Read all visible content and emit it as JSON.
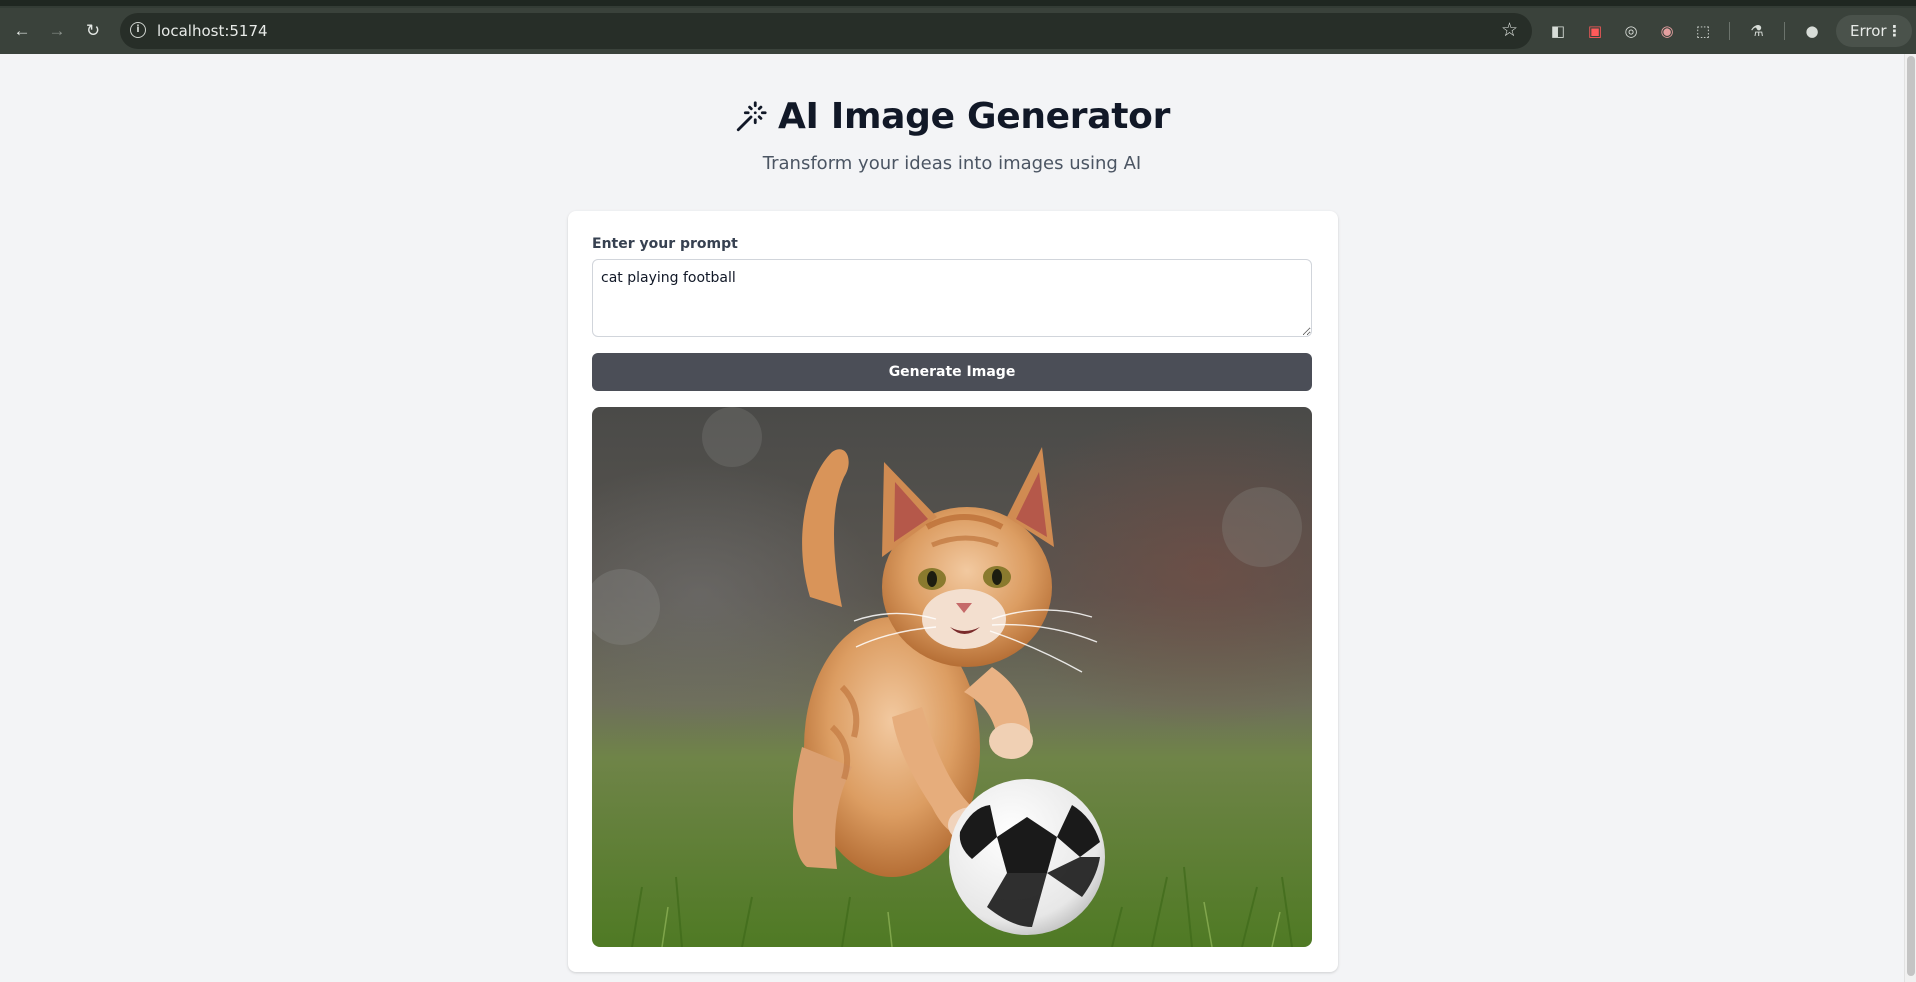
{
  "browser": {
    "url": "localhost:5174",
    "status_label": "Error",
    "icons": [
      "back-icon",
      "forward-icon",
      "reload-icon",
      "site-info-icon",
      "star-icon",
      "extensions-icon",
      "labs-icon",
      "profile-icon",
      "menu-icon"
    ]
  },
  "page": {
    "title": "AI Image Generator",
    "subtitle": "Transform your ideas into images using AI"
  },
  "form": {
    "prompt_label": "Enter your prompt",
    "prompt_value": "cat playing football",
    "generate_label": "Generate Image"
  },
  "result": {
    "image_description_icon": "generated-image"
  },
  "colors": {
    "page_bg": "#f3f4f6",
    "button_bg": "#4b4e57",
    "title_text": "#111827",
    "browser_toolbar": "#3a423b"
  }
}
